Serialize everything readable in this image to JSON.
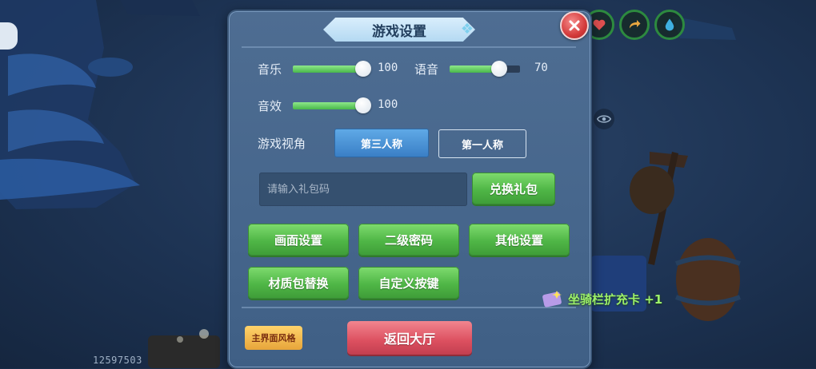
{
  "dialog": {
    "title": "游戏设置",
    "close_icon": "close-icon"
  },
  "audio": {
    "music_label": "音乐",
    "music_value": "100",
    "music_level": 1.0,
    "voice_label": "语音",
    "voice_value": "70",
    "voice_level": 0.7,
    "sfx_label": "音效",
    "sfx_value": "100",
    "sfx_level": 1.0
  },
  "view": {
    "label": "游戏视角",
    "options": [
      "第三人称",
      "第一人称"
    ],
    "selected": "第三人称"
  },
  "gift": {
    "placeholder": "请输入礼包码",
    "redeem_label": "兑换礼包"
  },
  "buttons": {
    "graphics": "画面设置",
    "second_password": "二级密码",
    "other_settings": "其他设置",
    "texture_pack": "材质包替换",
    "custom_keys": "自定义按键",
    "main_ui_style": "主界面风格",
    "return_lobby": "返回大厅"
  },
  "hud": {
    "player_id": "12597503",
    "notification": "坐骑栏扩充卡 +1",
    "icons": [
      "heart-icon",
      "arrow-icon",
      "water-drop-icon",
      "eye-icon"
    ]
  },
  "colors": {
    "accent_green": "#4fb646",
    "accent_blue": "#3a7fc6",
    "danger_red": "#dc4f5f",
    "panel_blue": "#4e6d92"
  }
}
